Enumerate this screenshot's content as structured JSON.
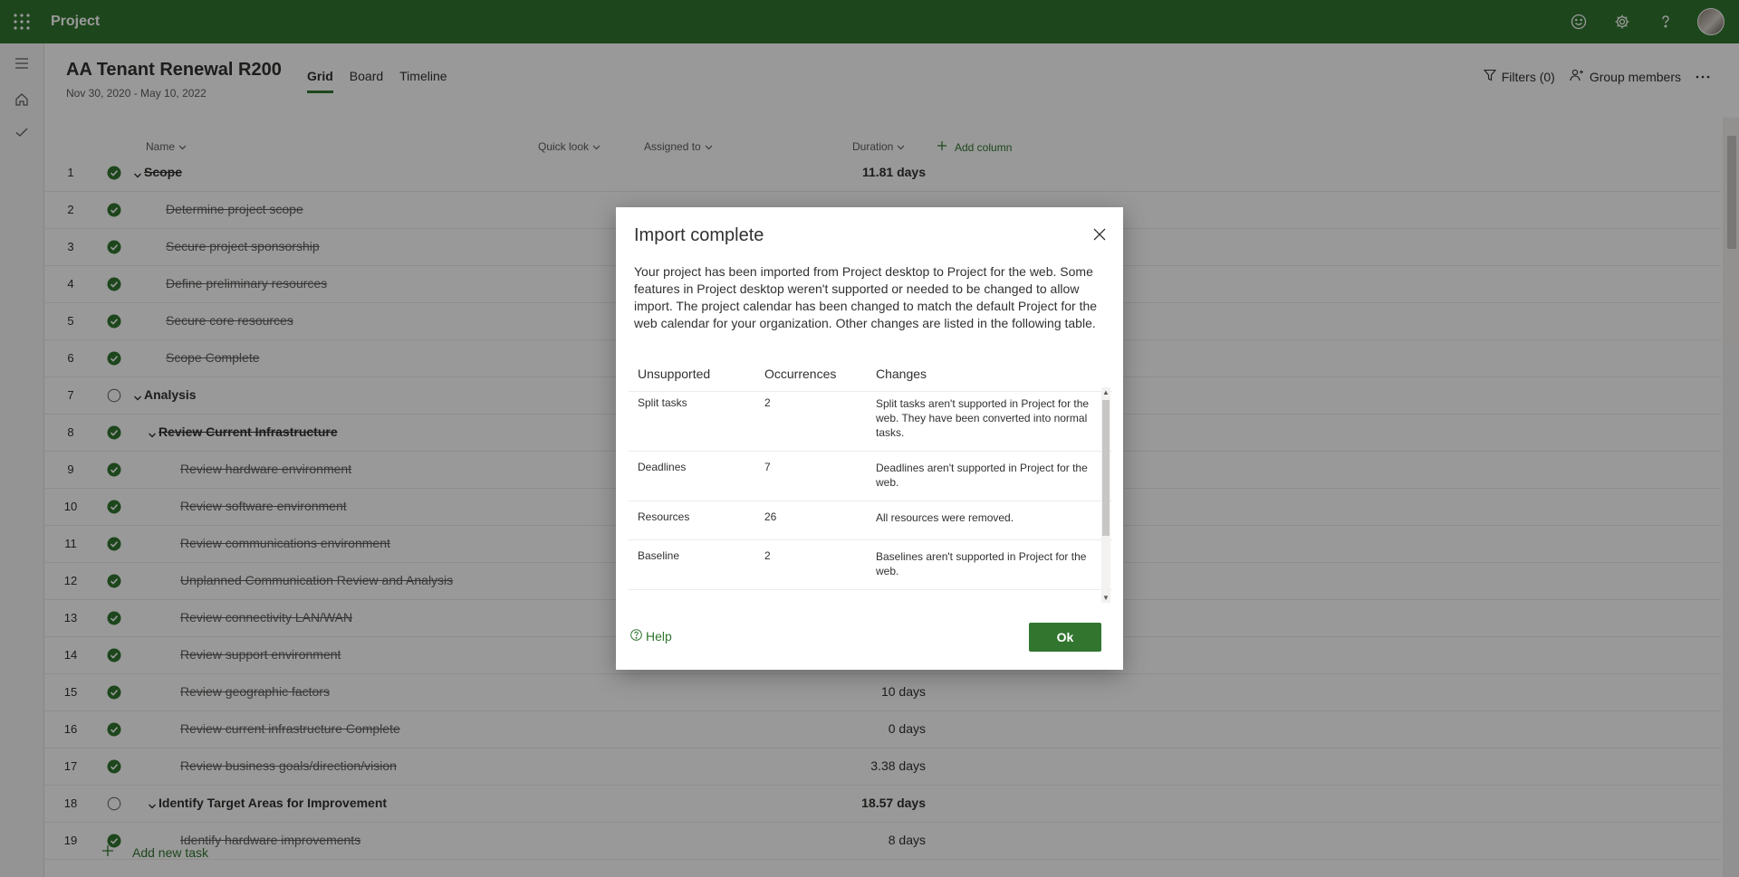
{
  "topbar": {
    "app_name": "Project"
  },
  "project": {
    "title": "AA Tenant Renewal R200",
    "dates": "Nov 30, 2020 - May 10, 2022",
    "tabs": [
      "Grid",
      "Board",
      "Timeline"
    ]
  },
  "toolbar": {
    "filters_label": "Filters (0)",
    "group_members_label": "Group members"
  },
  "columns": {
    "name": "Name",
    "quick_look": "Quick look",
    "assigned_to": "Assigned to",
    "duration": "Duration",
    "add_column": "Add column"
  },
  "tasks": [
    {
      "num": "1",
      "name": "Scope",
      "done": true,
      "summary": true,
      "level": 0,
      "duration": "11.81 days"
    },
    {
      "num": "2",
      "name": "Determine project scope",
      "done": true,
      "summary": false,
      "level": 1,
      "duration": ""
    },
    {
      "num": "3",
      "name": "Secure project sponsorship",
      "done": true,
      "summary": false,
      "level": 1,
      "duration": ""
    },
    {
      "num": "4",
      "name": "Define preliminary resources",
      "done": true,
      "summary": false,
      "level": 1,
      "duration": ""
    },
    {
      "num": "5",
      "name": "Secure core resources",
      "done": true,
      "summary": false,
      "level": 1,
      "duration": ""
    },
    {
      "num": "6",
      "name": "Scope Complete",
      "done": true,
      "summary": false,
      "level": 1,
      "duration": ""
    },
    {
      "num": "7",
      "name": "Analysis",
      "done": false,
      "summary": true,
      "level": 0,
      "duration": ""
    },
    {
      "num": "8",
      "name": "Review Current Infrastructure",
      "done": true,
      "summary": true,
      "level": 1,
      "duration": ""
    },
    {
      "num": "9",
      "name": "Review hardware environment",
      "done": true,
      "summary": false,
      "level": 2,
      "duration": ""
    },
    {
      "num": "10",
      "name": "Review software environment",
      "done": true,
      "summary": false,
      "level": 2,
      "duration": ""
    },
    {
      "num": "11",
      "name": "Review communications environment",
      "done": true,
      "summary": false,
      "level": 2,
      "duration": ""
    },
    {
      "num": "12",
      "name": "Unplanned Communication Review and Analysis",
      "done": true,
      "summary": false,
      "level": 2,
      "duration": ""
    },
    {
      "num": "13",
      "name": "Review connectivity LAN/WAN",
      "done": true,
      "summary": false,
      "level": 2,
      "duration": ""
    },
    {
      "num": "14",
      "name": "Review support environment",
      "done": true,
      "summary": false,
      "level": 2,
      "duration": ""
    },
    {
      "num": "15",
      "name": "Review geographic factors",
      "done": true,
      "summary": false,
      "level": 2,
      "duration": "10 days"
    },
    {
      "num": "16",
      "name": "Review current infrastructure Complete",
      "done": true,
      "summary": false,
      "level": 2,
      "duration": "0 days"
    },
    {
      "num": "17",
      "name": "Review business goals/direction/vision",
      "done": true,
      "summary": false,
      "level": 2,
      "duration": "3.38 days"
    },
    {
      "num": "18",
      "name": "Identify Target Areas for Improvement",
      "done": false,
      "summary": true,
      "level": 1,
      "duration": "18.57 days"
    },
    {
      "num": "19",
      "name": "Identify hardware improvements",
      "done": true,
      "summary": false,
      "level": 2,
      "duration": "8 days"
    }
  ],
  "add_task_label": "Add new task",
  "dialog": {
    "title": "Import complete",
    "description": "Your project has been imported from Project desktop to Project for the web. Some features in Project desktop weren't supported or needed to be changed to allow import. The project calendar has been changed to match the default Project for the web calendar for your organization. Other changes are listed in the following table.",
    "table_headers": [
      "Unsupported",
      "Occurrences",
      "Changes"
    ],
    "table_rows": [
      {
        "unsupported": "Split tasks",
        "occurrences": "2",
        "changes": "Split tasks aren't supported in Project for the web. They have been converted into normal tasks."
      },
      {
        "unsupported": "Deadlines",
        "occurrences": "7",
        "changes": "Deadlines aren't supported in Project for the web."
      },
      {
        "unsupported": "Resources",
        "occurrences": "26",
        "changes": "All resources were removed."
      },
      {
        "unsupported": "Baseline",
        "occurrences": "2",
        "changes": "Baselines aren't supported in Project for the web."
      }
    ],
    "help_label": "Help",
    "ok_label": "Ok"
  },
  "colors": {
    "brand": "#31752f",
    "overlay": "rgba(0,0,0,0.40)"
  },
  "icons": [
    "app-launcher-icon",
    "smiley-icon",
    "gear-icon",
    "help-icon",
    "hamburger-icon",
    "home-icon",
    "checkmark-icon",
    "filter-icon",
    "group-members-icon",
    "more-icon",
    "chevron-down-icon",
    "plus-icon",
    "completed-check-icon",
    "empty-circle-icon",
    "close-icon",
    "help-circle-icon"
  ]
}
